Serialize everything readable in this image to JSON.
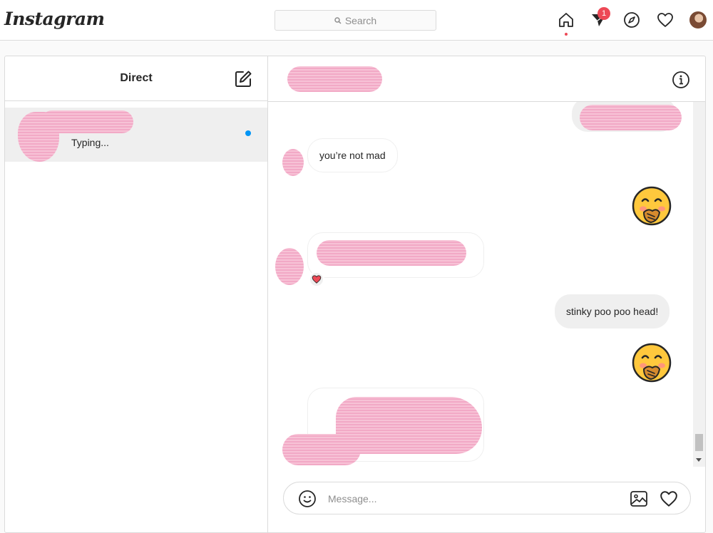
{
  "app": {
    "logo_text": "Instagram"
  },
  "search": {
    "placeholder": "Search"
  },
  "nav": {
    "icons": [
      "home-icon",
      "direct-icon",
      "explore-icon",
      "activity-heart-icon",
      "profile-avatar"
    ],
    "direct_badge": "1"
  },
  "inbox": {
    "title": "Direct",
    "threads": [
      {
        "status": "Typing...",
        "unread": true
      }
    ]
  },
  "chat": {
    "messages": [
      {
        "from": "me",
        "type": "text-redacted"
      },
      {
        "from": "them",
        "type": "text",
        "text": "you’re not mad"
      },
      {
        "from": "me",
        "type": "emoji",
        "emoji": "face-with-hand-over-mouth"
      },
      {
        "from": "them",
        "type": "text-redacted",
        "reaction": "heart"
      },
      {
        "from": "me",
        "type": "text",
        "text": "stinky poo poo head!"
      },
      {
        "from": "me",
        "type": "emoji",
        "emoji": "face-with-hand-over-mouth"
      },
      {
        "from": "them",
        "type": "text-redacted"
      }
    ]
  },
  "composer": {
    "placeholder": "Message..."
  },
  "colors": {
    "badge": "#ed4956",
    "unread_dot": "#0095f6",
    "border": "#dbdbdb",
    "bubble_out": "#efefef",
    "redaction": "#f4b3cd"
  }
}
